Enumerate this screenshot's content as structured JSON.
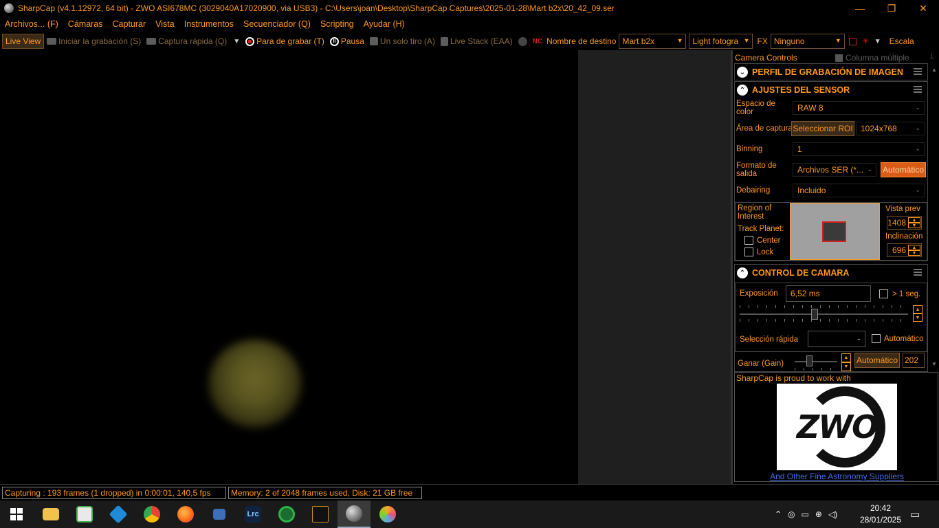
{
  "window": {
    "title": "SharpCap (v4.1.12972, 64 bit) - ZWO ASI678MC (3029040A17020900, via USB3) - C:\\Users\\joan\\Desktop\\SharpCap Captures\\2025-01-28\\Mart b2x\\20_42_09.ser",
    "minimize": "—",
    "maximize": "❐",
    "close": "✕"
  },
  "menu": [
    "Archivos... (F)",
    "Cámaras",
    "Capturar",
    "Vista",
    "Instrumentos",
    "Secuenciador (Q)",
    "Scripting",
    "Ayudar (H)"
  ],
  "toolbar": {
    "live_view": "Live View",
    "start_capture": "Iniciar la grabación (S)",
    "quick_capture": "Captura rápida (Q)",
    "stop_recording": "Para de grabar (T)",
    "pause": "Pausa",
    "single_shot": "Un solo tiro (A)",
    "live_stack": "Live Stack (EAA)",
    "target_name_label": "Nombre de destino",
    "target_name": "Mart b2x",
    "capture_type": "Light fotogra",
    "fx_label": "FX",
    "fx_value": "Ninguno",
    "scale_label": "Escala"
  },
  "panel": {
    "title": "Camera Controls",
    "multi_column": "Columna múltiple",
    "profile_section": "PERFIL DE GRABACIÓN DE IMAGEN",
    "sensor_section": "AJUSTES DEL SENSOR",
    "color_space_label": "Espacio de color",
    "color_space_value": "RAW 8",
    "capture_area_label": "Área de captura",
    "select_roi": "Seleccionar ROI",
    "capture_area_value": "1024x768",
    "binning_label": "Binning",
    "binning_value": "1",
    "output_format_label": "Formato de salida",
    "output_format_value": "Archivos SER (*...",
    "output_auto": "Automático",
    "debayer_label": "Debairing",
    "debayer_value": "Incluido",
    "roi_label": "Region of Interest",
    "track_planet": "Track Planet:",
    "center": "Center",
    "lock": "Lock",
    "preview_label": "Vista prev",
    "preview_value": "1408",
    "tilt_label": "Inclinación",
    "tilt_value": "696",
    "camera_section": "CONTROL DE CAMARA",
    "exposure_label": "Exposición",
    "exposure_value": "6,52 ms",
    "over_one_sec": "> 1 seg.",
    "quick_select_label": "Selección rápida",
    "quick_select_auto": "Automático",
    "gain_label": "Ganar (Gain)",
    "gain_auto": "Automático",
    "gain_value": "202"
  },
  "promo": {
    "text": "SharpCap is proud to work with",
    "logo_text": "ZWO",
    "link": "And Other Fine Astronomy Suppliers"
  },
  "status": {
    "capturing": "Capturing : 193 frames (1 dropped) in 0:00:01, 140,5 fps",
    "memory": "Memory: 2 of 2048 frames used, Disk: 21 GB free"
  },
  "taskbar": {
    "time": "20:42",
    "date": "28/01/2025"
  },
  "colors": {
    "accent": "#ff9a1e",
    "panel_bg": "#000000",
    "auto_button": "#d85b16"
  }
}
